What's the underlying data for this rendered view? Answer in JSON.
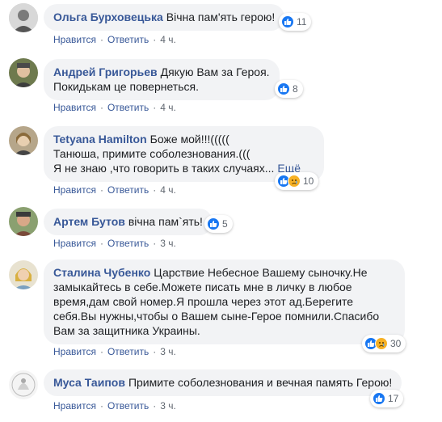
{
  "comments": [
    {
      "author": "Ольга Бурховецька",
      "text": "Вічна пам'ять герою!",
      "more": "",
      "actions": {
        "like": "Нравится",
        "reply": "Ответить",
        "time": "4 ч."
      },
      "reactions": {
        "count": "11",
        "icons": [
          "like"
        ]
      }
    },
    {
      "author": "Андрей Григорьев",
      "text": "Дякую Вам за Героя.\nПокидькам це повернеться.",
      "more": "",
      "actions": {
        "like": "Нравится",
        "reply": "Ответить",
        "time": "4 ч."
      },
      "reactions": {
        "count": "8",
        "icons": [
          "like"
        ]
      }
    },
    {
      "author": "Tetyana Hamilton",
      "text": "Боже мой!!!(((((\nТанюша, примите соболезнования.(((\nЯ не знаю ,что говорить в таких случаях...",
      "more": "Ещё",
      "actions": {
        "like": "Нравится",
        "reply": "Ответить",
        "time": "4 ч."
      },
      "reactions": {
        "count": "10",
        "icons": [
          "like",
          "sad"
        ]
      }
    },
    {
      "author": "Артем Бутов",
      "text": "вічна пам`ять!",
      "more": "",
      "actions": {
        "like": "Нравится",
        "reply": "Ответить",
        "time": "3 ч."
      },
      "reactions": {
        "count": "5",
        "icons": [
          "like"
        ]
      }
    },
    {
      "author": "Сталина Чубенко",
      "text": "Царствие Небесное Вашему сыночку.Не замыкайтесь в себе.Можете писать мне в личку в любое время,дам свой номер.Я прошла через этот ад.Берегите себя.Вы нужны,чтобы о Вашем сыне-Герое помнили.Спасибо Вам за защитника Украины.",
      "more": "",
      "actions": {
        "like": "Нравится",
        "reply": "Ответить",
        "time": "3 ч."
      },
      "reactions": {
        "count": "30",
        "icons": [
          "like",
          "sad"
        ]
      }
    },
    {
      "author": "Муса Таипов",
      "text": "Примите соболезнования и вечная память Герою!",
      "more": "",
      "actions": {
        "like": "Нравится",
        "reply": "Ответить",
        "time": "3 ч."
      },
      "reactions": {
        "count": "17",
        "icons": [
          "like"
        ]
      }
    }
  ],
  "colors": {
    "author": "#385898",
    "bubble": "#f2f3f5",
    "like": "#1877f2",
    "sad": "#f7b125",
    "meta": "#606770"
  }
}
